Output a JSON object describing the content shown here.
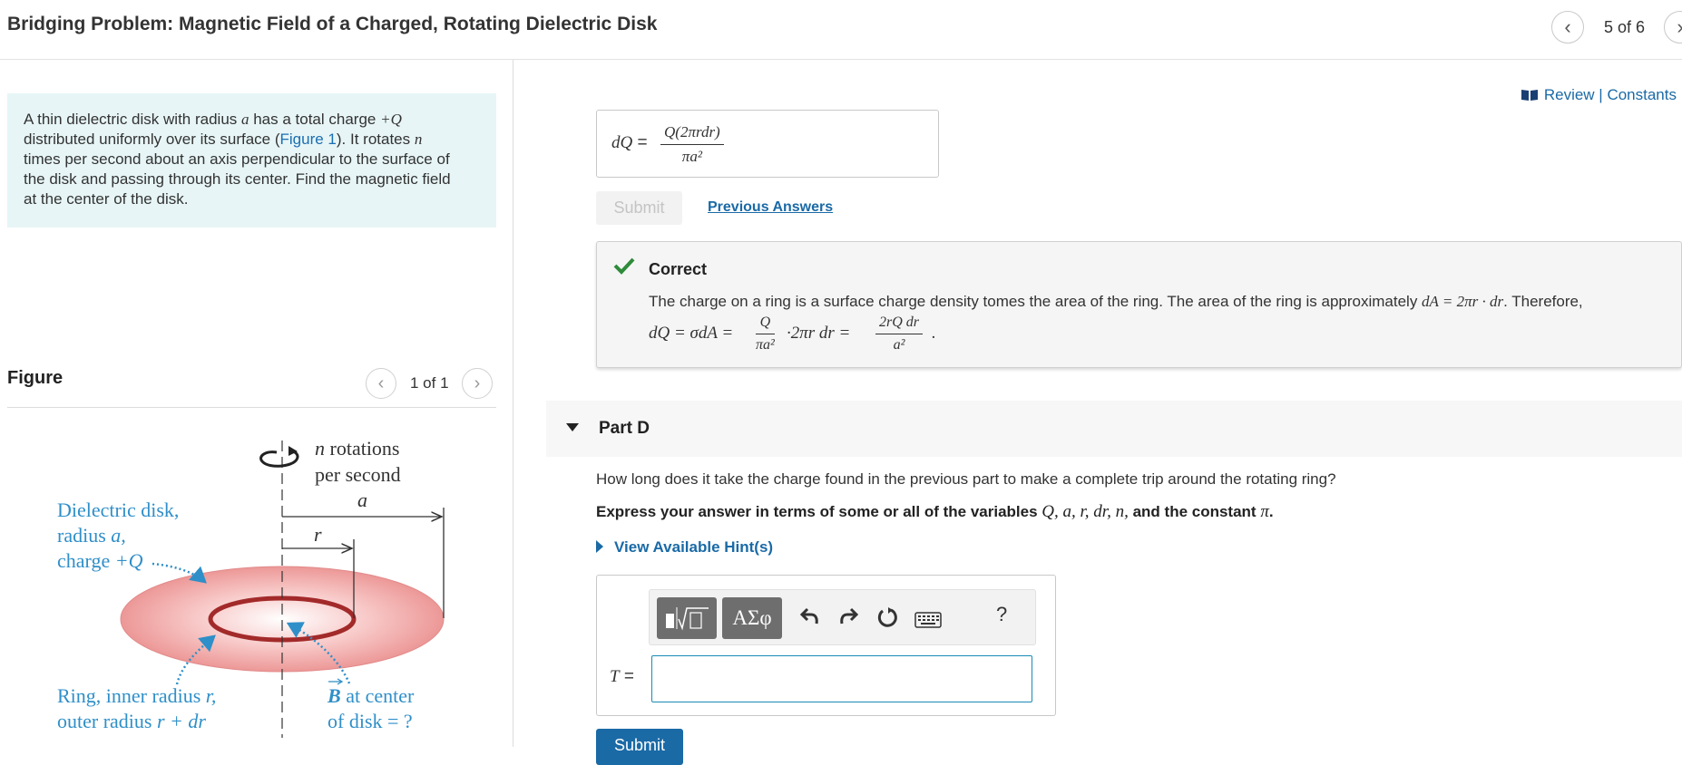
{
  "header": {
    "title": "Bridging Problem: Magnetic Field of a Charged, Rotating Dielectric Disk",
    "pagination": "5 of 6"
  },
  "problem": {
    "text_1": "A thin dielectric disk with radius ",
    "var_a": "a",
    "text_2": " has a total charge ",
    "var_Q": "+Q",
    "text_3": "distributed uniformly over its surface (",
    "figure_link": "Figure 1",
    "text_4": "). It rotates ",
    "var_n": "n",
    "text_5": "times per second about an axis perpendicular to the surface of",
    "text_6": "the disk and passing through its center. Find the magnetic field",
    "text_7": "at the center of the disk."
  },
  "figure": {
    "title": "Figure",
    "pagination": "1 of 1",
    "labels": {
      "n_rotations": "n",
      "rotations": " rotations",
      "per_second": "per second",
      "a": "a",
      "r": "r",
      "disk_1": "Dielectric disk,",
      "disk_2_text": "radius ",
      "disk_2_var": "a,",
      "disk_3_text": "charge ",
      "disk_3_var": "+Q",
      "ring_1_text": "Ring, inner radius ",
      "ring_1_var": "r,",
      "ring_2_text": "outer radius ",
      "ring_2_var": "r + dr",
      "b_1_var": "B",
      "b_1_text": " at center",
      "b_2": "of disk = ?"
    }
  },
  "right": {
    "review_label": "Review | Constants",
    "answer": {
      "lhs": "dQ",
      "equals": "=",
      "numerator": "Q(2πrdr)",
      "denominator": "πa²"
    },
    "submit_label": "Submit",
    "previous_answers_label": "Previous Answers",
    "feedback": {
      "title": "Correct",
      "text": "The charge on a ring is a surface charge density tomes the area of the ring. The area of the ring is approximately ",
      "text_math": "dA = 2πr · dr",
      "text_end": ". Therefore,",
      "eq_lhs": "dQ = σdA =",
      "frac1_num": "Q",
      "frac1_den": "πa²",
      "eq_mid": "·2πr dr =",
      "frac2_num": "2rQ dr",
      "frac2_den": "a²",
      "eq_end": "."
    },
    "part": {
      "label": "Part D",
      "question": "How long does it take the charge found in the previous part to make a complete trip around the rotating ring?",
      "express_text": "Express your answer in terms of some or all of the variables ",
      "express_vars": "Q, a, r, dr, n,",
      "express_and": " and the constant ",
      "express_pi": "π",
      "express_end": ".",
      "hints_label": "View Available Hint(s)",
      "greek_label": "ΑΣφ",
      "help_label": "?",
      "input_lhs": "T",
      "input_equals": "=",
      "submit_label": "Submit"
    }
  },
  "colors": {
    "link": "#1a6aa6",
    "problem_bg": "#e7f5f6",
    "correct_check": "#2e8b3a",
    "figure_blue": "#2f8fc8",
    "disk_red": "#e8878a"
  }
}
